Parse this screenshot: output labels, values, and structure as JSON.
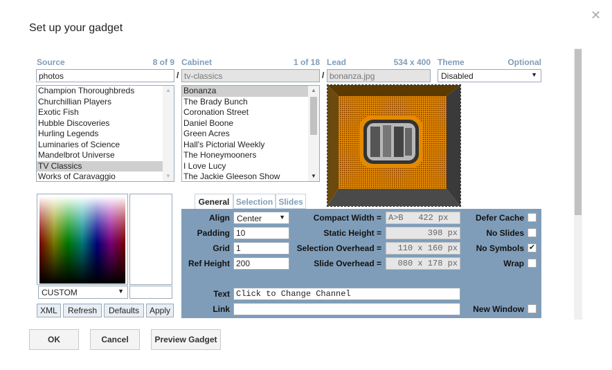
{
  "dialog": {
    "title": "Set up your gadget"
  },
  "source": {
    "label": "Source",
    "count": "8 of 9",
    "value": "photos",
    "items": [
      "Champion Thoroughbreds",
      "Churchillian Players",
      "Exotic Fish",
      "Hubble Discoveries",
      "Hurling Legends",
      "Luminaries of Science",
      "Mandelbrot Universe",
      "TV Classics",
      "Works of Caravaggio"
    ],
    "selected_index": 7
  },
  "cabinet": {
    "label": "Cabinet",
    "count": "1 of 18",
    "value": "tv-classics",
    "items": [
      "Bonanza",
      "The Brady Bunch",
      "Coronation Street",
      "Daniel Boone",
      "Green Acres",
      "Hall's Pictorial Weekly",
      "The Honeymooners",
      "I Love Lucy",
      "The Jackie Gleeson Show"
    ],
    "selected_index": 0
  },
  "lead": {
    "label": "Lead",
    "size": "534 x 400",
    "value": "bonanza.jpg"
  },
  "theme": {
    "label": "Theme",
    "hint": "Optional",
    "value": "Disabled"
  },
  "separator": "/",
  "color_picker": {
    "mode": "CUSTOM",
    "hex_value": ""
  },
  "buttons": {
    "xml": "XML",
    "refresh": "Refresh",
    "defaults": "Defaults",
    "apply": "Apply"
  },
  "tabs": [
    "General",
    "Selection",
    "Slides"
  ],
  "form": {
    "align_label": "Align",
    "align_value": "Center",
    "padding_label": "Padding",
    "padding_value": "10",
    "grid_label": "Grid",
    "grid_value": "1",
    "ref_height_label": "Ref Height",
    "ref_height_value": "200",
    "compact_width_label": "Compact Width =",
    "compact_width_value": "A>B   422 px",
    "static_height_label": "Static Height =",
    "static_height_value": "398 px",
    "selection_overhead_label": "Selection Overhead =",
    "selection_overhead_value": "110 x 160 px",
    "slide_overhead_label": "Slide Overhead =",
    "slide_overhead_value": "080 x 178 px",
    "defer_cache_label": "Defer Cache",
    "defer_cache": false,
    "no_slides_label": "No Slides",
    "no_slides": false,
    "no_symbols_label": "No Symbols",
    "no_symbols": true,
    "wrap_label": "Wrap",
    "wrap": false,
    "text_label": "Text",
    "text_value": "Click to Change Channel",
    "link_label": "Link",
    "link_value": "",
    "new_window_label": "New Window",
    "new_window": false
  },
  "footer": {
    "ok": "OK",
    "cancel": "Cancel",
    "preview": "Preview Gadget"
  },
  "icons": {
    "close": "close-icon",
    "check": "✔",
    "arrow": "▼",
    "up": "▲"
  },
  "colors": {
    "accent": "#7f9db9",
    "panel": "#7f9db9",
    "frame_orange": "#e38a00",
    "frame_dark": "#5a3a00"
  }
}
